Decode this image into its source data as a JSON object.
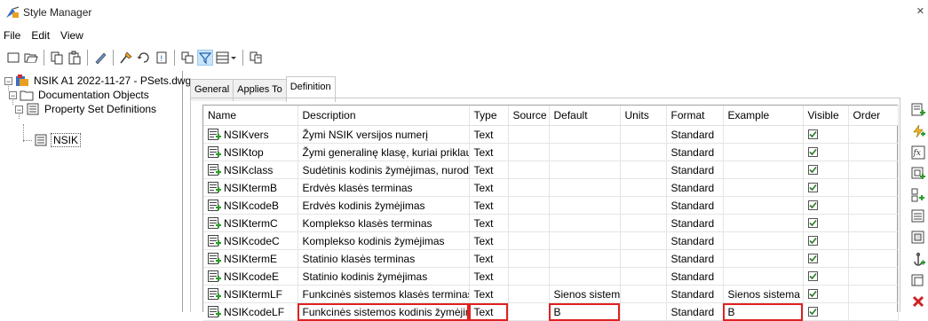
{
  "window": {
    "title": "Style Manager",
    "close_glyph": "✕"
  },
  "menu": [
    "File",
    "Edit",
    "View"
  ],
  "toolbar": {
    "icons": [
      "new-icon",
      "open-icon",
      "copy-icon",
      "paste-icon",
      "edit-icon",
      "purge-icon",
      "sort-icon",
      "help-icon",
      "toggle-view-icon",
      "filter-icon",
      "view-dropdown-icon",
      "inline-edit-icon"
    ],
    "active": "filter-icon"
  },
  "tree": {
    "root": "NSIK A1 2022-11-27 - PSets.dwg",
    "category": "Documentation Objects",
    "folder": "Property Set Definitions",
    "item": "NSIK"
  },
  "tabs": [
    "General",
    "Applies To",
    "Definition"
  ],
  "active_tab": "Definition",
  "table": {
    "columns": [
      "Name",
      "Description",
      "Type",
      "Source",
      "Default",
      "Units",
      "Format",
      "Example",
      "Visible",
      "Order"
    ],
    "rows": [
      [
        "NSIKvers",
        "Žymi NSIK versijos numerį",
        "Text",
        "",
        "",
        "",
        "Standard",
        "",
        "true",
        ""
      ],
      [
        "NSIKtop",
        "Žymi generalinę klasę, kuriai priklau...",
        "Text",
        "",
        "",
        "",
        "Standard",
        "",
        "true",
        ""
      ],
      [
        "NSIKclass",
        "Sudėtinis kodinis žymėjimas, nurod...",
        "Text",
        "",
        "",
        "",
        "Standard",
        "",
        "true",
        ""
      ],
      [
        "NSIKtermB",
        "Erdvės klasės terminas",
        "Text",
        "",
        "",
        "",
        "Standard",
        "",
        "true",
        ""
      ],
      [
        "NSIKcodeB",
        "Erdvės kodinis žymėjimas",
        "Text",
        "",
        "",
        "",
        "Standard",
        "",
        "true",
        ""
      ],
      [
        "NSIKtermC",
        "Komplekso klasės terminas",
        "Text",
        "",
        "",
        "",
        "Standard",
        "",
        "true",
        ""
      ],
      [
        "NSIKcodeC",
        "Komplekso kodinis žymėjimas",
        "Text",
        "",
        "",
        "",
        "Standard",
        "",
        "true",
        ""
      ],
      [
        "NSIKtermE",
        "Statinio klasės terminas",
        "Text",
        "",
        "",
        "",
        "Standard",
        "",
        "true",
        ""
      ],
      [
        "NSIKcodeE",
        "Statinio kodinis žymėjimas",
        "Text",
        "",
        "",
        "",
        "Standard",
        "",
        "true",
        ""
      ],
      [
        "NSIKtermLF",
        "Funkcinės sistemos klasės terminas",
        "Text",
        "",
        "Sienos sistema",
        "",
        "Standard",
        "Sienos sistema",
        "true",
        ""
      ],
      [
        "NSIKcodeLF",
        "Funkcinės sistemos kodinis žymėjim...",
        "Text",
        "",
        "B",
        "",
        "Standard",
        "B",
        "true",
        ""
      ]
    ]
  },
  "side_buttons": [
    "add-property-icon",
    "auto-property-icon",
    "formula-property-icon",
    "location-property-icon",
    "classification-property-icon",
    "list-property-icon",
    "anchor-property-icon",
    "graphic-property-icon",
    "edit-property-icon",
    "delete-property-icon"
  ],
  "colors": {
    "highlight": "#e02020",
    "selection_fill": "#cce4f7"
  }
}
